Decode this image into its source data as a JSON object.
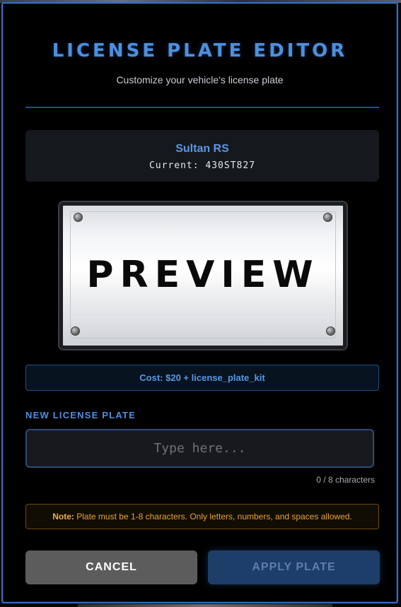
{
  "header": {
    "title": "LICENSE PLATE EDITOR",
    "subtitle": "Customize your vehicle's license plate"
  },
  "vehicle": {
    "name": "Sultan RS",
    "current_plate": "Current: 430ST827"
  },
  "preview": {
    "plate_text": "PREVIEW"
  },
  "cost": {
    "text": "Cost: $20 + license_plate_kit"
  },
  "input": {
    "label": "NEW LICENSE PLATE",
    "value": "",
    "placeholder": "Type here...",
    "char_count": "0 / 8 characters"
  },
  "note": {
    "prefix": "Note:",
    "text": " Plate must be 1-8 characters. Only letters, numbers, and spaces allowed."
  },
  "buttons": {
    "cancel_label": "CANCEL",
    "apply_label": "APPLY PLATE"
  },
  "colors": {
    "accent": "#4d8fe0",
    "warning": "#e8a332",
    "cancel_bg": "#5c5c5c",
    "apply_bg": "#1d3e69"
  },
  "icons": {
    "plate_bolts": "bolt-icon"
  }
}
